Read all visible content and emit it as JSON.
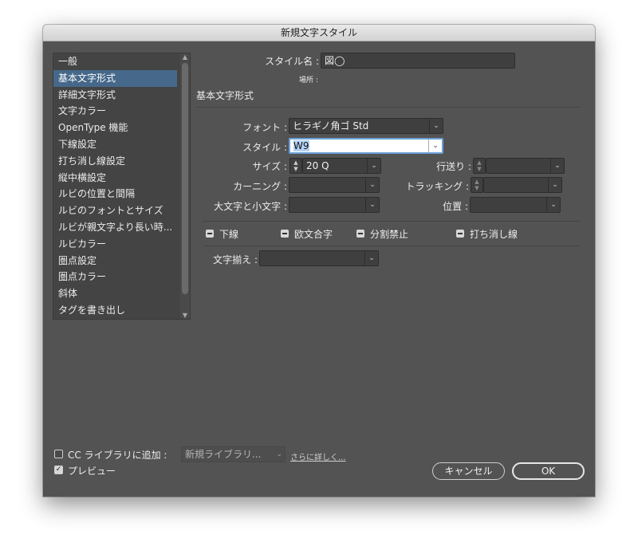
{
  "window": {
    "title": "新規文字スタイル"
  },
  "panel": {
    "items": [
      {
        "label": "一般",
        "selected": false
      },
      {
        "label": "基本文字形式",
        "selected": true
      },
      {
        "label": "詳細文字形式",
        "selected": false
      },
      {
        "label": "文字カラー",
        "selected": false
      },
      {
        "label": "OpenType 機能",
        "selected": false
      },
      {
        "label": "下線設定",
        "selected": false
      },
      {
        "label": "打ち消し線設定",
        "selected": false
      },
      {
        "label": "縦中横設定",
        "selected": false
      },
      {
        "label": "ルビの位置と間隔",
        "selected": false
      },
      {
        "label": "ルビのフォントとサイズ",
        "selected": false
      },
      {
        "label": "ルビが親文字より長い時...",
        "selected": false
      },
      {
        "label": "ルビカラー",
        "selected": false
      },
      {
        "label": "圏点設定",
        "selected": false
      },
      {
        "label": "圏点カラー",
        "selected": false
      },
      {
        "label": "斜体",
        "selected": false
      },
      {
        "label": "タグを書き出し",
        "selected": false
      }
    ]
  },
  "style_name": {
    "label": "スタイル名 :",
    "value": "図◯"
  },
  "location": {
    "label": "場所 :"
  },
  "section": {
    "title": "基本文字形式"
  },
  "font": {
    "label": "フォント :",
    "value": "ヒラギノ角ゴ Std"
  },
  "style": {
    "label": "スタイル :",
    "value": "W9"
  },
  "size": {
    "label": "サイズ :",
    "value": "20 Q"
  },
  "leading": {
    "label": "行送り :",
    "value": ""
  },
  "kerning": {
    "label": "カーニング :",
    "value": ""
  },
  "tracking": {
    "label": "トラッキング :",
    "value": ""
  },
  "case": {
    "label": "大文字と小文字 :",
    "value": ""
  },
  "position": {
    "label": "位置 :",
    "value": ""
  },
  "toggles": {
    "underline": "下線",
    "tatechuyoko": "欧文合字",
    "no_break": "分割禁止",
    "strikethrough": "打ち消し線"
  },
  "alignment": {
    "label": "文字揃え :",
    "value": ""
  },
  "footer": {
    "cc_label": "CC ライブラリに追加 :",
    "cc_checked": false,
    "library_value": "新規ライブラリ...",
    "learn_more": "さらに詳しく...",
    "preview_label": "プレビュー",
    "preview_checked": true,
    "cancel": "キャンセル",
    "ok": "OK"
  },
  "icons": {
    "caret": "chevron-down-icon",
    "stepper": "up-down-stepper-icon",
    "check": "checkmark-icon"
  }
}
